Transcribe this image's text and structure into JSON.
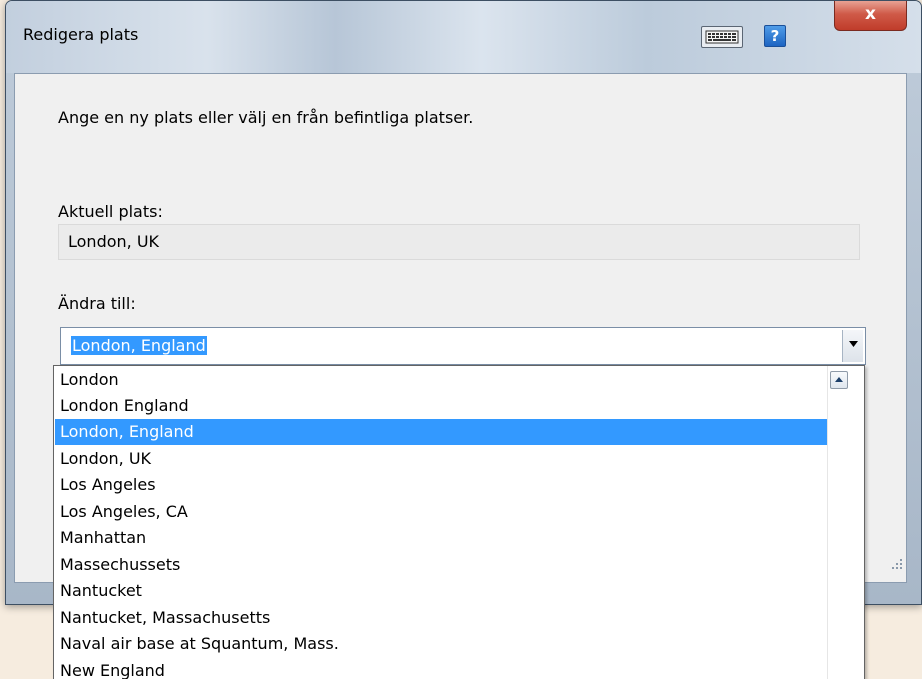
{
  "window": {
    "title": "Redigera plats",
    "help_label": "?",
    "close_label": "x"
  },
  "dialog": {
    "instruction": "Ange en ny plats eller välj en från befintliga platser.",
    "current_label": "Aktuell plats:",
    "current_value": "London, UK",
    "change_label": "Ändra till:",
    "change_value": "London, England"
  },
  "dropdown": {
    "items": [
      {
        "label": "London"
      },
      {
        "label": "London England"
      },
      {
        "label": "London, England",
        "selected": true
      },
      {
        "label": "London, UK"
      },
      {
        "label": "Los Angeles"
      },
      {
        "label": "Los Angeles, CA"
      },
      {
        "label": "Manhattan"
      },
      {
        "label": "Massechussets"
      },
      {
        "label": "Nantucket"
      },
      {
        "label": "Nantucket, Massachusetts"
      },
      {
        "label": "Naval air base at Squantum, Mass."
      },
      {
        "label": "New England"
      }
    ]
  },
  "icons": {
    "keyboard": "keyboard-icon",
    "help": "help-icon",
    "close": "close-icon",
    "dropdown_arrow": "chevron-down-icon",
    "scroll_up": "chevron-up-icon"
  },
  "colors": {
    "selection": "#3399ff",
    "close_button": "#c8473a",
    "help_button": "#2f7dd8"
  }
}
